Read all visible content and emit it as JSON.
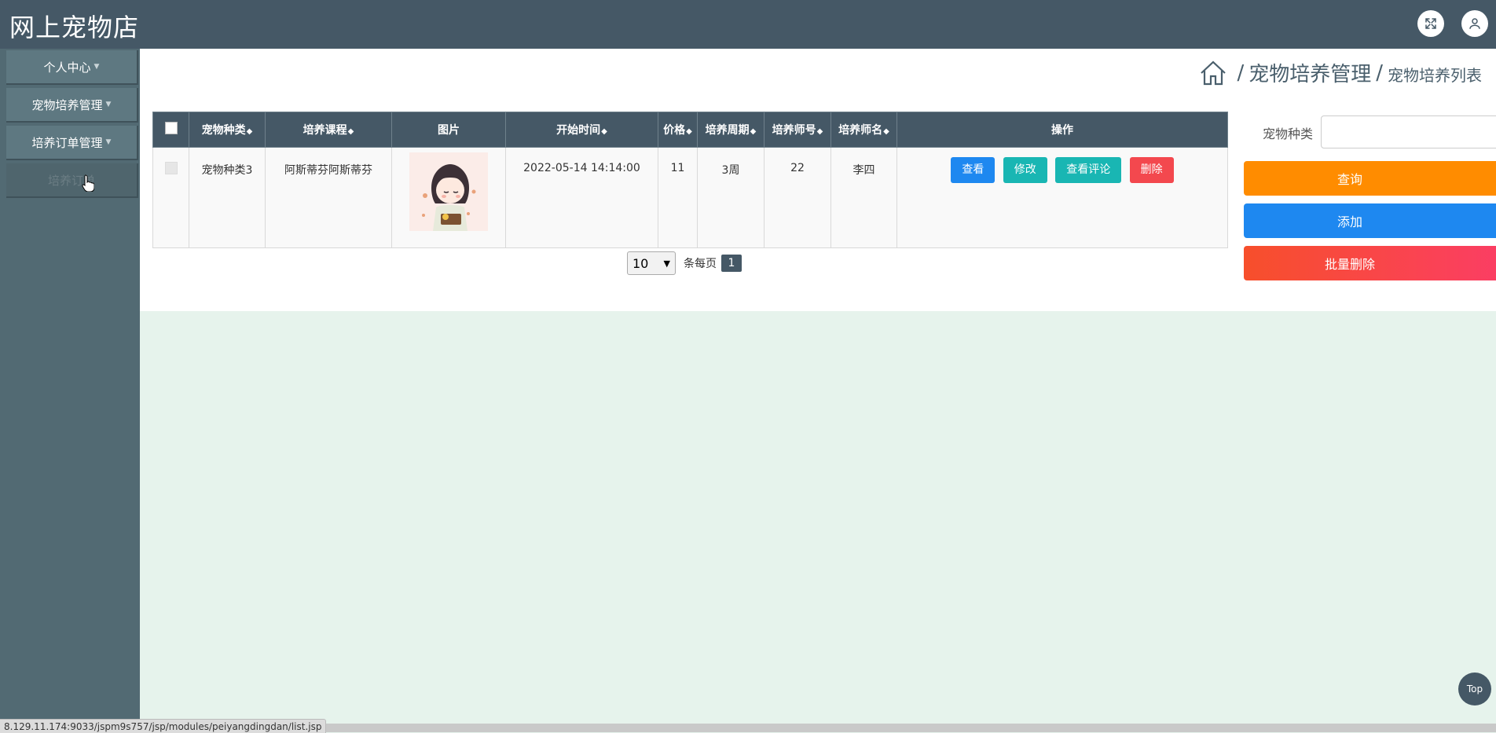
{
  "header": {
    "title": "网上宠物店"
  },
  "sidebar": {
    "items": [
      {
        "label": "个人中心"
      },
      {
        "label": "宠物培养管理"
      },
      {
        "label": "培养订单管理"
      },
      {
        "label": "培养订单"
      }
    ]
  },
  "breadcrumb": {
    "section": "宠物培养管理",
    "current": "宠物培养列表",
    "separator": "/"
  },
  "table": {
    "headers": [
      "宠物种类",
      "培养课程",
      "图片",
      "开始时间",
      "价格",
      "培养周期",
      "培养师号",
      "培养师名",
      "操作"
    ],
    "rows": [
      {
        "category": "宠物种类3",
        "course": "阿斯蒂芬阿斯蒂芬",
        "start_time": "2022-05-14 14:14:00",
        "price": "11",
        "period": "3周",
        "trainer_no": "22",
        "trainer_name": "李四",
        "actions": [
          "查看",
          "修改",
          "查看评论",
          "删除"
        ]
      }
    ]
  },
  "pagination": {
    "page_size": "10",
    "per_page_label": "条每页",
    "current_page": "1"
  },
  "search": {
    "label": "宠物种类",
    "placeholder": ""
  },
  "side_buttons": {
    "query": "查询",
    "add": "添加",
    "batch_delete": "批量删除"
  },
  "back_to_top": "Top",
  "status_url": "8.129.11.174:9033/jspm9s757/jsp/modules/peiyangdingdan/list.jsp",
  "colors": {
    "header": "#455866",
    "sidebar": "#526a73",
    "primary": "#1e88f0",
    "teal": "#19b6b3",
    "danger": "#f3484e",
    "orange": "#ff8c00"
  }
}
